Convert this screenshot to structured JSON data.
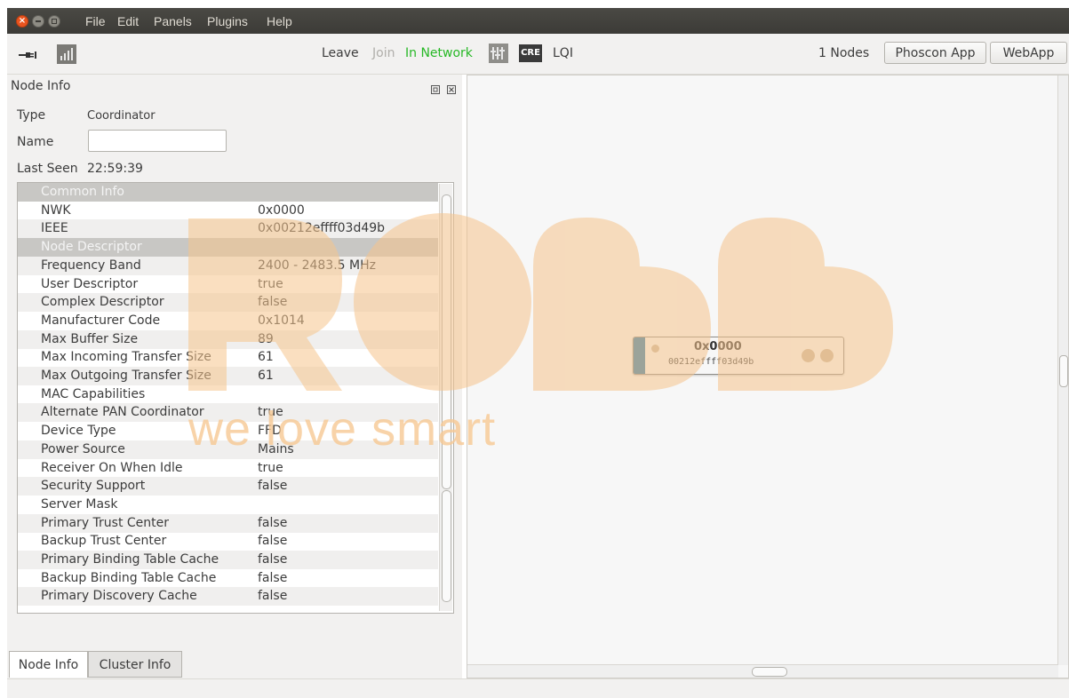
{
  "menu": [
    "File",
    "Edit",
    "Panels",
    "Plugins",
    "Help"
  ],
  "toolbar": {
    "leave": "Leave",
    "join": "Join",
    "network_status": "In Network",
    "cre_label": "CRE",
    "lqi": "LQI",
    "node_count": "1 Nodes",
    "phoscon_app": "Phoscon App",
    "webapp": "WebApp"
  },
  "colors": {
    "network_status": "#27b826",
    "node_accent": "#2d7bab",
    "watermark": "#f7c994"
  },
  "node_info": {
    "title": "Node Info",
    "type_label": "Type",
    "type_value": "Coordinator",
    "name_label": "Name",
    "name_value": "",
    "last_seen_label": "Last Seen",
    "last_seen_value": "22:59:39"
  },
  "table": {
    "rows": [
      {
        "key": "Common Info",
        "value": "",
        "section": true
      },
      {
        "key": "NWK",
        "value": "0x0000"
      },
      {
        "key": "IEEE",
        "value": "0x00212effff03d49b"
      },
      {
        "key": "Node Descriptor",
        "value": "",
        "section": true
      },
      {
        "key": "Frequency Band",
        "value": "2400 - 2483.5 MHz"
      },
      {
        "key": "User Descriptor",
        "value": "true"
      },
      {
        "key": "Complex Descriptor",
        "value": "false"
      },
      {
        "key": "Manufacturer Code",
        "value": "0x1014"
      },
      {
        "key": "Max Buffer Size",
        "value": "89"
      },
      {
        "key": "Max Incoming Transfer Size",
        "value": "61"
      },
      {
        "key": "Max Outgoing Transfer Size",
        "value": "61"
      },
      {
        "key": "MAC Capabilities",
        "value": ""
      },
      {
        "key": "Alternate PAN Coordinator",
        "value": "true"
      },
      {
        "key": "Device Type",
        "value": "FFD"
      },
      {
        "key": "Power Source",
        "value": "Mains"
      },
      {
        "key": "Receiver On When Idle",
        "value": "true"
      },
      {
        "key": "Security Support",
        "value": "false"
      },
      {
        "key": "Server Mask",
        "value": ""
      },
      {
        "key": "Primary Trust Center",
        "value": "false"
      },
      {
        "key": "Backup Trust Center",
        "value": "false"
      },
      {
        "key": "Primary Binding Table Cache",
        "value": "false"
      },
      {
        "key": "Backup Binding Table Cache",
        "value": "false"
      },
      {
        "key": "Primary Discovery Cache",
        "value": "false"
      }
    ]
  },
  "tabs": [
    "Node Info",
    "Cluster Info"
  ],
  "graph_node": {
    "nwk": "0x0000",
    "ieee": "00212effff03d49b"
  },
  "watermark": {
    "text": "we love smart"
  }
}
